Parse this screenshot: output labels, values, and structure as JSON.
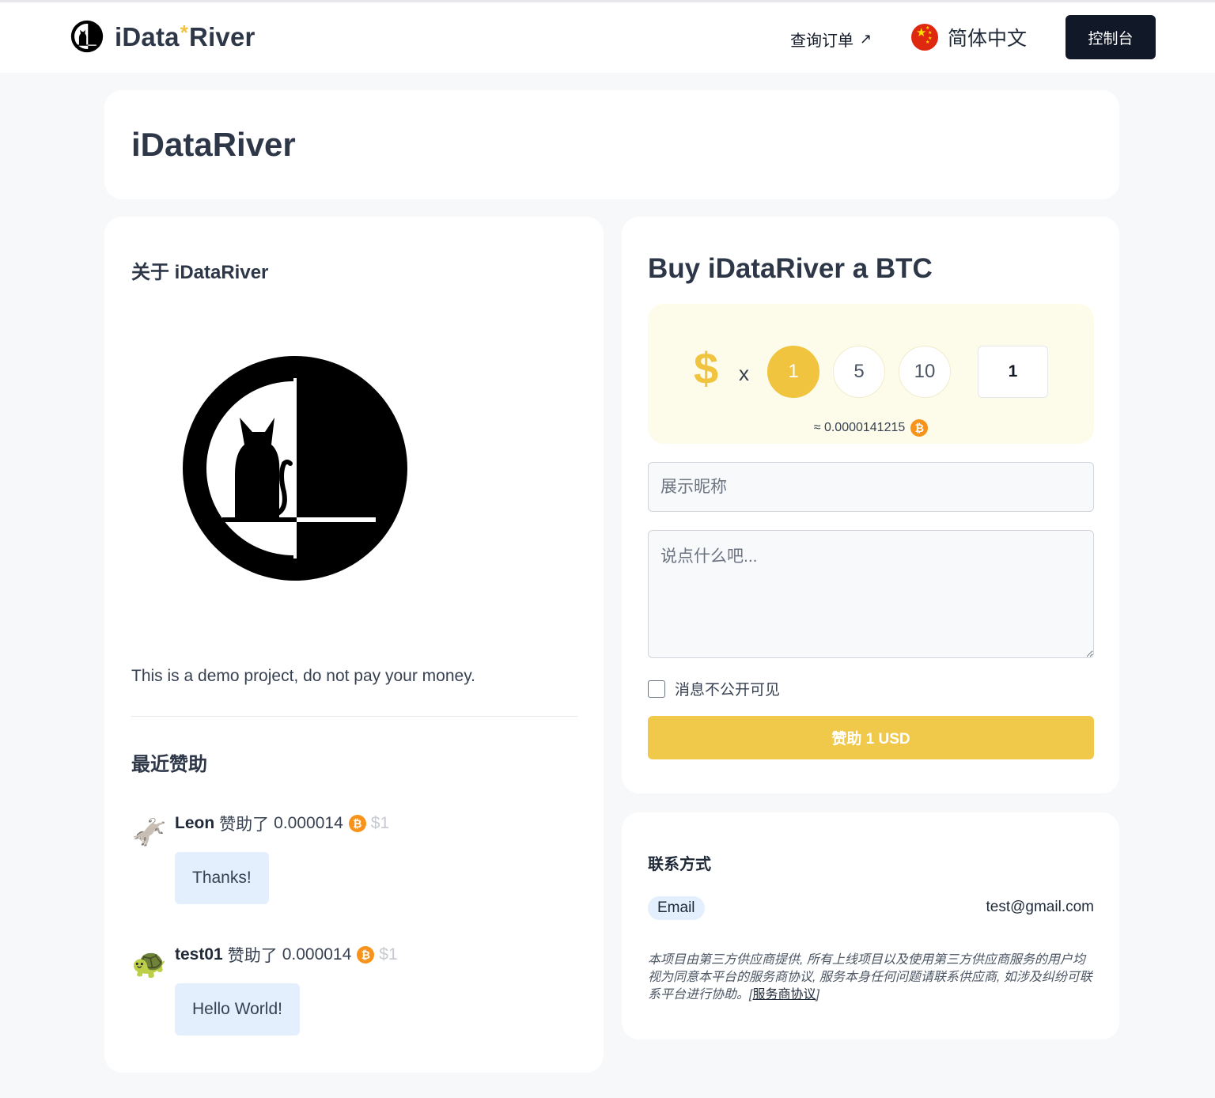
{
  "header": {
    "brand_left": "iData",
    "brand_star": "*",
    "brand_right": "River",
    "orders_link": "查询订单",
    "orders_arrow": "↗",
    "language": "简体中文",
    "console_button": "控制台"
  },
  "page": {
    "title": "iDataRiver"
  },
  "about": {
    "title": "关于 iDataRiver",
    "description": "This is a demo project, do not pay your money."
  },
  "recent": {
    "title": "最近赞助",
    "items": [
      {
        "emoji": "🫏",
        "name": "Leon",
        "action": "赞助了",
        "amount": "0.000014",
        "usd": "$1",
        "message": "Thanks!"
      },
      {
        "emoji": "🐢",
        "name": "test01",
        "action": "赞助了",
        "amount": "0.000014",
        "usd": "$1",
        "message": "Hello World!"
      }
    ]
  },
  "buy": {
    "title": "Buy iDataRiver a BTC",
    "currency_symbol": "$",
    "times": "x",
    "presets": [
      "1",
      "5",
      "10"
    ],
    "selected_preset": "1",
    "quantity": "1",
    "approx": "≈ 0.0000141215",
    "btc_symbol": "₿",
    "nickname_placeholder": "展示昵称",
    "message_placeholder": "说点什么吧...",
    "private_label": "消息不公开可见",
    "private_checked": false,
    "submit_label": "赞助 1 USD"
  },
  "contact": {
    "title": "联系方式",
    "email_label": "Email",
    "email_value": "test@gmail.com",
    "disclaimer": "本项目由第三方供应商提供, 所有上线项目以及使用第三方供应商服务的用户均视为同意本平台的服务商协议, 服务本身任何问题请联系供应商, 如涉及纠纷可联系平台进行协助。",
    "agreement_open": "[",
    "agreement_link": "服务商协议",
    "agreement_close": "]"
  },
  "colors": {
    "accent": "#f0c43f",
    "dark_button": "#111827",
    "bubble": "#e3effc",
    "btc": "#f7931a",
    "panel": "#fdfcea",
    "background": "#f7f8fa"
  },
  "icons": {
    "brand_logo": "cat-moon-logo-icon",
    "language_flag": "china-flag-icon",
    "btc": "bitcoin-icon"
  }
}
